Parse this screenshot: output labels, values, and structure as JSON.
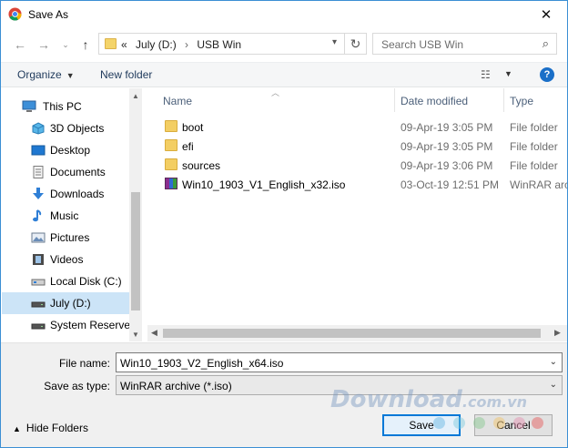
{
  "window": {
    "title": "Save As"
  },
  "nav": {
    "crumbs": [
      "«",
      "July (D:)",
      "USB Win"
    ],
    "crumb_sep": "›",
    "search_placeholder": "Search USB Win"
  },
  "commands": {
    "organize": "Organize",
    "new_folder": "New folder"
  },
  "sidebar": {
    "items": [
      {
        "label": "This PC",
        "icon": "computer-icon"
      },
      {
        "label": "3D Objects",
        "icon": "cube-icon"
      },
      {
        "label": "Desktop",
        "icon": "desktop-icon"
      },
      {
        "label": "Documents",
        "icon": "document-icon"
      },
      {
        "label": "Downloads",
        "icon": "download-arrow-icon"
      },
      {
        "label": "Music",
        "icon": "music-note-icon"
      },
      {
        "label": "Pictures",
        "icon": "picture-icon"
      },
      {
        "label": "Videos",
        "icon": "film-icon"
      },
      {
        "label": "Local Disk (C:)",
        "icon": "hard-drive-icon"
      },
      {
        "label": "July (D:)",
        "icon": "usb-drive-icon"
      },
      {
        "label": "System Reserved",
        "icon": "hard-drive-icon"
      }
    ],
    "selected": "July (D:)"
  },
  "list": {
    "columns": [
      "Name",
      "Date modified",
      "Type"
    ],
    "rows": [
      {
        "name": "boot",
        "date": "09-Apr-19 3:05 PM",
        "type": "File folder",
        "icon": "folder-icon"
      },
      {
        "name": "efi",
        "date": "09-Apr-19 3:05 PM",
        "type": "File folder",
        "icon": "folder-icon"
      },
      {
        "name": "sources",
        "date": "09-Apr-19 3:06 PM",
        "type": "File folder",
        "icon": "folder-icon"
      },
      {
        "name": "Win10_1903_V1_English_x32.iso",
        "date": "03-Oct-19 12:51 PM",
        "type": "WinRAR arch",
        "icon": "winrar-archive-icon"
      }
    ]
  },
  "form": {
    "file_name_label": "File name:",
    "file_name_value": "Win10_1903_V2_English_x64.iso",
    "save_type_label": "Save as type:",
    "save_type_value": "WinRAR archive (*.iso)"
  },
  "footer": {
    "hide_folders": "Hide Folders",
    "save": "Save",
    "cancel": "Cancel",
    "watermark": "Download",
    "watermark_suffix": ".com.vn"
  },
  "colors": {
    "accent": "#0078d7",
    "selection": "#cce4f7",
    "help": "#1a6fc8"
  }
}
